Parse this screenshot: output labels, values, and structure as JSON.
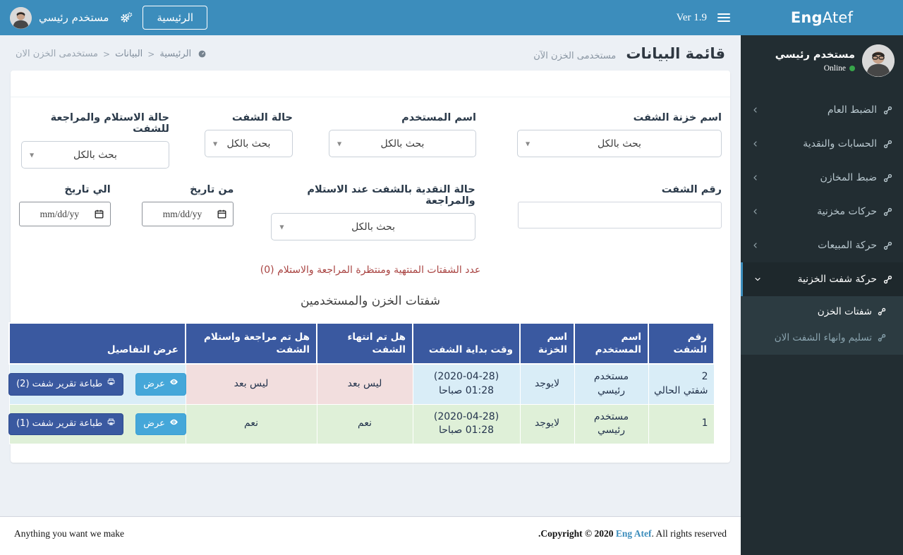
{
  "colors": {
    "brand_blue": "#3c8dbc",
    "sidebar_dark": "#222d32",
    "submenu_dark": "#2c3b41",
    "table_header_blue": "#3a59a0",
    "row_info_blue": "#d9edf7",
    "row_danger_pink": "#f2dede",
    "row_success_green": "#dff0d8",
    "alert_red": "#a94442",
    "online_green": "#37a64a",
    "view_button_blue": "#45a7d9"
  },
  "icons": {
    "select_caret": "▼"
  },
  "navbar": {
    "brand_bold": "Eng",
    "brand_light": "Atef",
    "version": "Ver 1.9",
    "home_button": "الرئيسية",
    "user_name": "مستخدم رئيسي"
  },
  "sidebar": {
    "user_name": "مستخدم رئيسي",
    "user_status": "Online",
    "items": [
      {
        "label": "الضبط العام"
      },
      {
        "label": "الحسابات والنقدية"
      },
      {
        "label": "ضبط المخازن"
      },
      {
        "label": "حركات مخزنية"
      },
      {
        "label": "حركة المبيعات"
      },
      {
        "label": "حركة شفت الخزنية"
      }
    ],
    "submenu": [
      {
        "label": "شفتات الخزن"
      },
      {
        "label": "تسليم وانهاء الشفت الان"
      }
    ]
  },
  "header": {
    "title": "قائمة البيانات",
    "subtitle": "مستخدمى الخزن الآن",
    "breadcrumb": {
      "home": "الرئيسية",
      "sep1": "<",
      "data": "البيانات",
      "sep2": "<",
      "current": "مستخدمى الخزن الان"
    }
  },
  "filters": {
    "search_all": "بحث بالكل",
    "treasury_label": "اسم خزنة الشفت",
    "user_label": "اسم المستخدم",
    "shift_status_label": "حالة الشفت",
    "review_status_label": "حالة الاستلام والمراجعة للشفت",
    "shift_number_label": "رقم الشفت",
    "shift_number_value": "",
    "cash_status_label": "حالة النقدية بالشفت عند الاستلام والمراجعة",
    "date_from_label": "من تاريخ",
    "date_to_label": "الي تاريخ",
    "date_placeholder": "mm/dd/yy"
  },
  "summary": {
    "pending_count_text": "عدد الشفتات المنتهية ومنتظرة المراجعة والاستلام (0)",
    "table_title": "شفتات الخزن والمستخدمين"
  },
  "table": {
    "headers": [
      "رقم الشفت",
      "اسم المستخدم",
      "اسم الخزنة",
      "وقت بداية الشفت",
      "هل تم انتهاء الشفت",
      "هل تم مراجعة واستلام الشفت",
      "عرض التفاصيل"
    ],
    "rows": [
      {
        "shift_number": "2",
        "shift_name": "شفتي الحالي",
        "user_name": "مستخدم رئيسي",
        "treasury_name": "لايوجد",
        "start_time": "(2020-04-28) 01:28 صباحا",
        "is_ended": "ليس بعد",
        "is_reviewed": "ليس بعد",
        "view_label": "عرض",
        "print_label": "طباعة تقرير شفت (2)"
      },
      {
        "shift_number": "1",
        "shift_name": "",
        "user_name": "مستخدم رئيسي",
        "treasury_name": "لايوجد",
        "start_time": "(2020-04-28) 01:28 صباحا",
        "is_ended": "نعم",
        "is_reviewed": "نعم",
        "view_label": "عرض",
        "print_label": "طباعة تقرير شفت (1)"
      }
    ]
  },
  "footer": {
    "left_text": "Anything you want we make",
    "copyright_prefix": ".Copyright © 2020 ",
    "copyright_link": "Eng Atef",
    "copyright_suffix": ". All rights reserved"
  }
}
